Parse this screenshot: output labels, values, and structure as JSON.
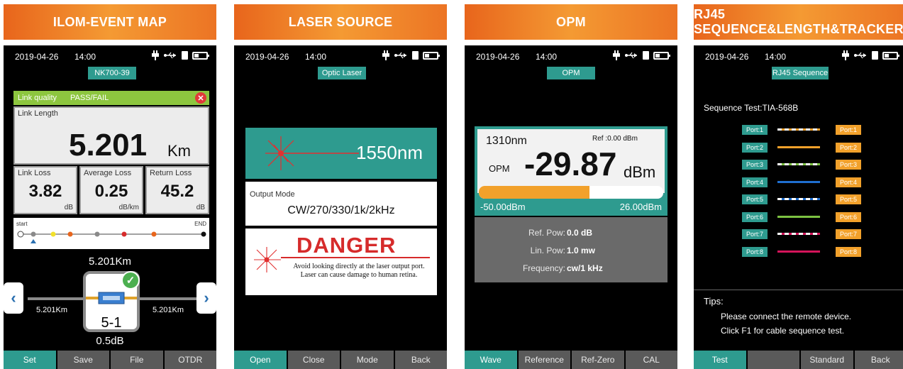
{
  "status": {
    "date": "2019-04-26",
    "time": "14:00"
  },
  "colors": {
    "accent": "#2e9b8f",
    "orange": "#f2a12b",
    "danger": "#d62b2b",
    "pass": "#8dc63f"
  },
  "p1": {
    "banner": "ILOM-EVENT MAP",
    "tag": "NK700-39",
    "link_quality_label": "Link quality",
    "link_quality_value": "PASS/FAIL",
    "link_length_label": "Link Length",
    "link_length_value": "5.201",
    "link_length_unit": "Km",
    "link_loss_label": "Link Loss",
    "link_loss_value": "3.82",
    "link_loss_unit": "dB",
    "avg_loss_label": "Average Loss",
    "avg_loss_value": "0.25",
    "avg_loss_unit": "dB/km",
    "return_loss_label": "Return Loss",
    "return_loss_value": "45.2",
    "return_loss_unit": "dB",
    "map_start": "start",
    "map_end": "END",
    "total_distance": "5.201Km",
    "left_distance": "5.201Km",
    "right_distance": "5.201Km",
    "event_id": "5-1",
    "event_loss": "0.5dB",
    "softkeys": [
      "Set",
      "Save",
      "File",
      "OTDR"
    ]
  },
  "p2": {
    "banner": "LASER SOURCE",
    "tag": "Optic Laser",
    "wavelength": "1550nm",
    "output_mode_label": "Output Mode",
    "output_mode_value": "CW/270/330/1k/2kHz",
    "danger_title": "DANGER",
    "danger_msg": "Avoid looking directly at the laser output port. Laser can cause damage to human retina.",
    "softkeys": [
      "Open",
      "Close",
      "Mode",
      "Back"
    ]
  },
  "p3": {
    "banner": "OPM",
    "tag": "OPM",
    "wavelength": "1310nm",
    "ref": "Ref :0.00  dBm",
    "mode": "OPM",
    "power_value": "-29.87",
    "power_unit": "dBm",
    "power_fraction": 0.6,
    "range_min": "-50.00dBm",
    "range_max": "26.00dBm",
    "ref_pow_label": "Ref. Pow:",
    "ref_pow_value": "0.0 dB",
    "lin_pow_label": "Lin. Pow:",
    "lin_pow_value": "1.0 mw",
    "freq_label": "Frequency:",
    "freq_value": "cw/1 kHz",
    "softkeys": [
      "Wave",
      "Reference",
      "Ref-Zero",
      "CAL"
    ]
  },
  "p4": {
    "banner": "RJ45 SEQUENCE&LENGTH&TRACKER",
    "tag": "RJ45 Sequence",
    "seq_test": "Sequence Test:TIA-568B",
    "ports": [
      {
        "left": "Port:1",
        "right": "Port:1"
      },
      {
        "left": "Port:2",
        "right": "Port:2"
      },
      {
        "left": "Port:3",
        "right": "Port:3"
      },
      {
        "left": "Port:4",
        "right": "Port:4"
      },
      {
        "left": "Port:5",
        "right": "Port:5"
      },
      {
        "left": "Port:6",
        "right": "Port:6"
      },
      {
        "left": "Port:7",
        "right": "Port:7"
      },
      {
        "left": "Port:8",
        "right": "Port:8"
      }
    ],
    "tips_label": "Tips:",
    "tip1": "Please connect the remote device.",
    "tip2": "Click F1 for cable sequence test.",
    "softkeys": [
      "Test",
      "",
      "Standard",
      "Back"
    ]
  }
}
